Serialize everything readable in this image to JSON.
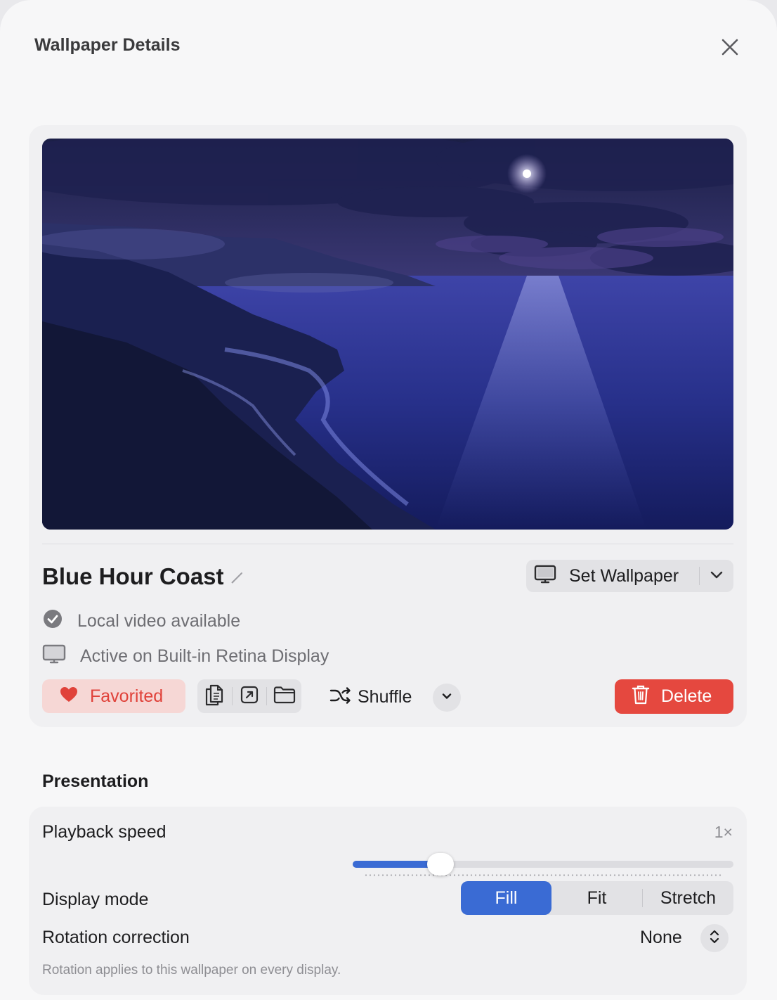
{
  "dialog": {
    "title": "Wallpaper Details"
  },
  "wallpaper": {
    "name": "Blue Hour Coast",
    "set_wallpaper_label": "Set Wallpaper",
    "status": [
      {
        "icon": "checkmark-circle-icon",
        "text": "Local video available"
      },
      {
        "icon": "display-icon",
        "text": "Active on Built-in Retina Display"
      }
    ]
  },
  "actions": {
    "favorite_label": "Favorited",
    "tools": [
      "copy-icon",
      "open-external-icon",
      "folder-icon"
    ],
    "shuffle_label": "Shuffle",
    "delete_label": "Delete"
  },
  "presentation": {
    "section_title": "Presentation",
    "playback_speed": {
      "label": "Playback speed",
      "value_text": "1×",
      "slider_fraction": 0.23
    },
    "display_mode": {
      "label": "Display mode",
      "options": [
        "Fill",
        "Fit",
        "Stretch"
      ],
      "selected": "Fill"
    },
    "rotation": {
      "label": "Rotation correction",
      "value": "None",
      "note": "Rotation applies to this wallpaper on every display."
    }
  },
  "colors": {
    "accent": "#3a6bd4",
    "danger": "#e5483f",
    "favorite_bg": "#f6d7d5",
    "favorite_fg": "#e0423a"
  }
}
